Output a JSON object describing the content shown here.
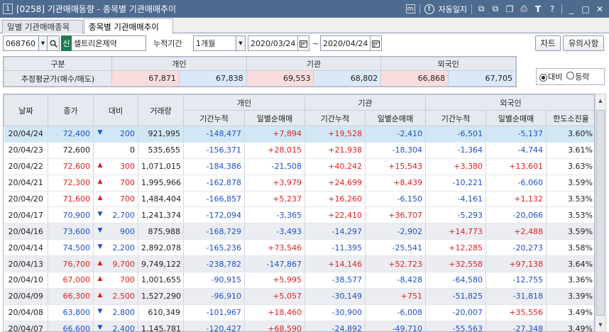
{
  "window": {
    "num": "1",
    "title": "[0258] 기관매매동향 - 종목별 기관매매추이",
    "right_label": "자동일지",
    "icons": [
      "m-icon",
      "alarm-icon",
      "link-icon",
      "popout-icon",
      "copy-icon",
      "print-icon",
      "font-icon",
      "help-icon",
      "minimize-icon",
      "maximize-icon",
      "close-icon"
    ],
    "glyphs": {
      "m": "m",
      "alarm": "!",
      "link": "⧉",
      "popout": "⧉",
      "copy": "❐",
      "print": "⎙",
      "font": "T",
      "help": "?",
      "minimize": "_",
      "maximize": "□",
      "close": "✕"
    }
  },
  "tabs": [
    {
      "label": "일별 기관매매종목"
    },
    {
      "label": "종목별 기관매매추이"
    }
  ],
  "controls": {
    "code": "068760",
    "market_badge": "신",
    "stock_name": "셀트리온제약",
    "period_label": "누적기간",
    "period_value": "1개월",
    "date_from": "2020/03/24",
    "tilde": "~",
    "date_to": "2020/04/24",
    "chart_button": "차트",
    "notice_button": "유의사항"
  },
  "summary": {
    "header_label": "구분",
    "row_label": "추정평균가(매수/매도)",
    "groups": [
      "개인",
      "기관",
      "외국인"
    ],
    "values": [
      "67,871",
      "67,838",
      "69,553",
      "68,802",
      "66,868",
      "67,705"
    ]
  },
  "radio": {
    "option1": "대비",
    "option2": "등락",
    "selected": "대비"
  },
  "grid": {
    "headers": {
      "date": "날짜",
      "close": "종가",
      "change": "대비",
      "volume": "거래량",
      "groups": [
        "개인",
        "기관",
        "외국인"
      ],
      "sub": [
        "기간누적",
        "일별순매매",
        "기간누적",
        "일별순매매",
        "기간누적",
        "일별순매매",
        "한도소진율"
      ]
    },
    "rows": [
      {
        "date": "20/04/24",
        "close": "72,400",
        "dir": "dn",
        "change": "200",
        "volume": "921,995",
        "vals": [
          "-148,477",
          "+7,894",
          "+19,528",
          "-2,410",
          "-6,501",
          "-5,137"
        ],
        "limit": "3.60%"
      },
      {
        "date": "20/04/23",
        "close": "72,600",
        "dir": "",
        "change": "0",
        "volume": "535,655",
        "vals": [
          "-156,371",
          "+28,015",
          "+21,938",
          "-18,304",
          "-1,364",
          "-4,744"
        ],
        "limit": "3.61%"
      },
      {
        "date": "20/04/22",
        "close": "72,600",
        "dir": "up",
        "change": "300",
        "volume": "1,071,015",
        "vals": [
          "-184,386",
          "-21,508",
          "+40,242",
          "+15,543",
          "+3,380",
          "+13,601"
        ],
        "limit": "3.63%"
      },
      {
        "date": "20/04/21",
        "close": "72,300",
        "dir": "up",
        "change": "700",
        "volume": "1,995,966",
        "vals": [
          "-162,878",
          "+3,979",
          "+24,699",
          "+8,439",
          "-10,221",
          "-6,060"
        ],
        "limit": "3.59%"
      },
      {
        "date": "20/04/20",
        "close": "71,600",
        "dir": "up",
        "change": "700",
        "volume": "1,484,404",
        "vals": [
          "-166,857",
          "+5,237",
          "+16,260",
          "-6,150",
          "-4,161",
          "+1,132"
        ],
        "limit": "3.53%"
      },
      {
        "date": "20/04/17",
        "close": "70,900",
        "dir": "dn",
        "change": "2,700",
        "volume": "1,241,374",
        "vals": [
          "-172,094",
          "-3,365",
          "+22,410",
          "+36,707",
          "-5,293",
          "-20,066"
        ],
        "limit": "3.53%"
      },
      {
        "date": "20/04/16",
        "close": "73,600",
        "dir": "dn",
        "change": "900",
        "volume": "875,988",
        "vals": [
          "-168,729",
          "-3,493",
          "-14,297",
          "-2,902",
          "+14,773",
          "+2,488"
        ],
        "limit": "3.59%"
      },
      {
        "date": "20/04/14",
        "close": "74,500",
        "dir": "dn",
        "change": "2,200",
        "volume": "2,892,078",
        "vals": [
          "-165,236",
          "+73,546",
          "-11,395",
          "-25,541",
          "+12,285",
          "-20,273"
        ],
        "limit": "3.58%"
      },
      {
        "date": "20/04/13",
        "close": "76,700",
        "dir": "up",
        "change": "9,700",
        "volume": "9,749,122",
        "vals": [
          "-238,782",
          "-147,867",
          "+14,146",
          "+52,723",
          "+32,558",
          "+97,138"
        ],
        "limit": "3.64%"
      },
      {
        "date": "20/04/10",
        "close": "67,000",
        "dir": "up",
        "change": "700",
        "volume": "1,001,655",
        "vals": [
          "-90,915",
          "+5,995",
          "-38,577",
          "-8,428",
          "-64,580",
          "-12,755"
        ],
        "limit": "3.36%"
      },
      {
        "date": "20/04/09",
        "close": "66,300",
        "dir": "up",
        "change": "2,500",
        "volume": "1,527,290",
        "vals": [
          "-96,910",
          "+5,057",
          "-30,149",
          "+751",
          "-51,825",
          "-31,818"
        ],
        "limit": "3.39%"
      },
      {
        "date": "20/04/08",
        "close": "63,800",
        "dir": "dn",
        "change": "2,800",
        "volume": "610,349",
        "vals": [
          "-101,967",
          "+18,460",
          "-30,900",
          "-6,008",
          "-20,007",
          "+35,556"
        ],
        "limit": "3.49%"
      },
      {
        "date": "20/04/07",
        "close": "66,600",
        "dir": "dn",
        "change": "2,400",
        "volume": "1,145,781",
        "vals": [
          "-120,427",
          "+68,590",
          "-24,892",
          "-49,710",
          "-55,563",
          "-27,348"
        ],
        "limit": "3.49%"
      }
    ]
  },
  "colors": {
    "up": "#e02020",
    "down": "#1f4fc8",
    "title_bar": "#4e6a8f",
    "selected_row": "#d2e7f5",
    "alt_row": "#ebedf2",
    "buy_cell": "#fadcdc",
    "sell_cell": "#dbe8f8"
  },
  "arrows": {
    "up": "▲",
    "dn": "▼"
  }
}
